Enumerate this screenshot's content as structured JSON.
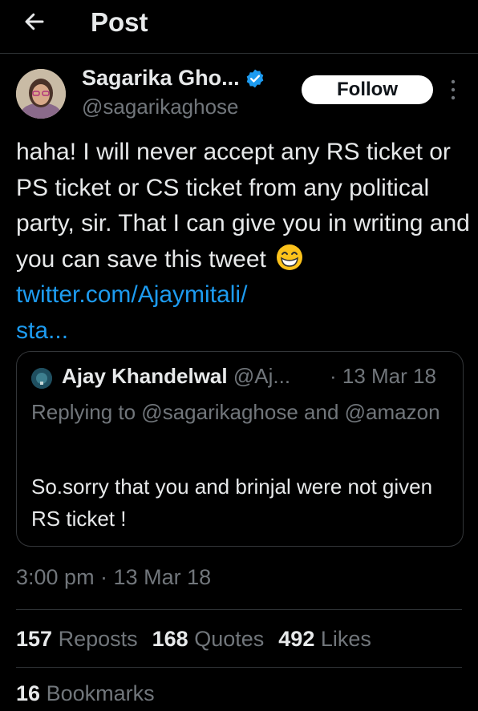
{
  "header": {
    "title": "Post",
    "back_icon": "arrow-left-icon"
  },
  "author": {
    "name": "Sagarika Gho...",
    "handle": "@sagarikaghose",
    "verified_icon": "verified-badge-icon",
    "follow_label": "Follow",
    "more_icon": "more-vertical-icon"
  },
  "post": {
    "text": "haha! I will never accept any RS ticket or PS ticket or CS ticket from any political party, sir. That I can give you in writing and you can save this tweet",
    "emoji": "grinning-face-emoji",
    "link_line1": "twitter.com/Ajaymitali/",
    "link_line2": "sta..."
  },
  "quote": {
    "name": "Ajay Khandelwal",
    "handle": "@Aj...",
    "date": "· 13 Mar 18",
    "replying_to": "Replying to @sagarikaghose and @amazon",
    "text": "So.sorry that you and brinjal were not given RS ticket !"
  },
  "timestamp": "3:00 pm · 13 Mar 18",
  "stats": {
    "reposts_count": "157",
    "reposts_label": "Reposts",
    "quotes_count": "168",
    "quotes_label": "Quotes",
    "likes_count": "492",
    "likes_label": "Likes",
    "bookmarks_count": "16",
    "bookmarks_label": "Bookmarks"
  },
  "colors": {
    "background": "#000000",
    "text": "#e7e9ea",
    "secondary": "#71767b",
    "link": "#1d9bf0",
    "divider": "#2f3336"
  }
}
